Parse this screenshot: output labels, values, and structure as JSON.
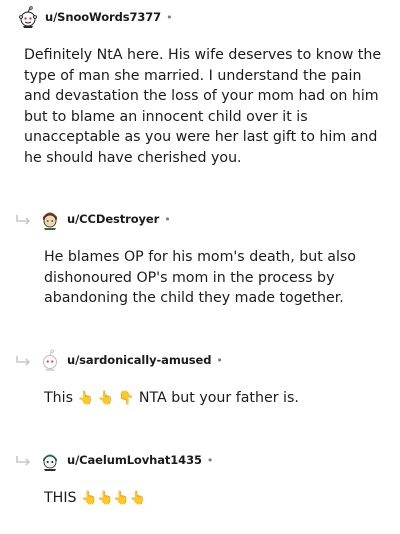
{
  "comments": [
    {
      "username": "u/SnooWords7377",
      "dot": "•",
      "body": "Definitely NtA here. His wife deserves to know the type of man she married. I understand the pain and devastation the loss of your mom had on him but to blame an innocent child over it is unacceptable as you were her last gift to him and he should have cherished you."
    },
    {
      "username": "u/CCDestroyer",
      "dot": "•",
      "body": "He blames OP for his mom's death, but also dishonoured OP's mom in the process by abandoning the child they made together."
    },
    {
      "username": "u/sardonically-amused",
      "dot": "•",
      "body_prefix": "This",
      "emojis": "👆 👆 👇",
      "body_suffix": "NTA but your father is."
    },
    {
      "username": "u/CaelumLovhat1435",
      "dot": "•",
      "body_prefix": "THIS",
      "emojis": "👆👆👆👆"
    }
  ],
  "icons": {
    "reply": "reply-arrow-icon",
    "avatar": "snoo-avatar-icon"
  },
  "colors": {
    "text": "#1c1c1c",
    "meta": "#7c7c7c",
    "reply_arrow": "#c8c8c8"
  }
}
